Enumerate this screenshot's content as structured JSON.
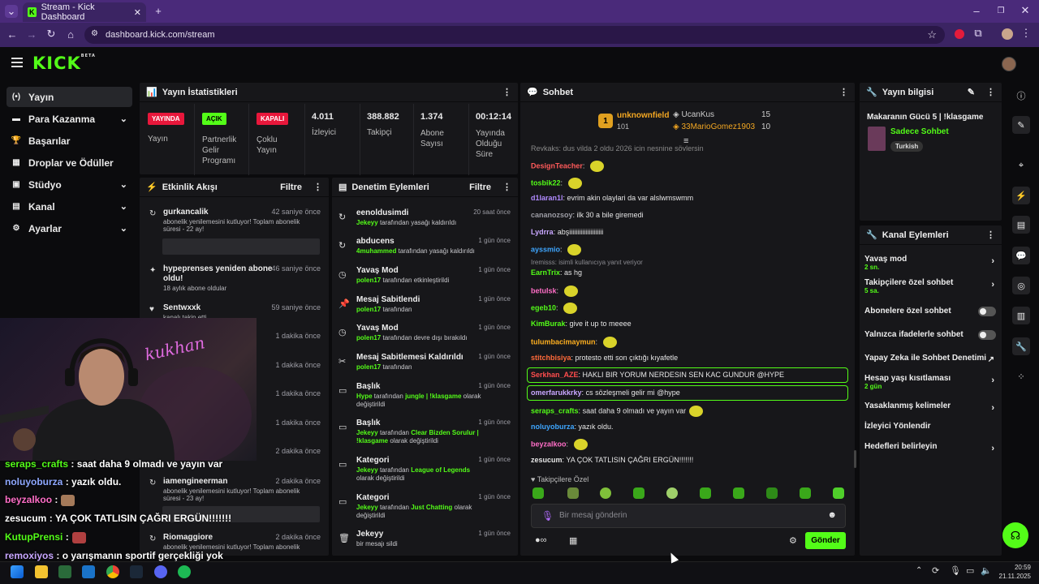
{
  "browser": {
    "tab_title": "Stream - Kick Dashboard",
    "url": "dashboard.kick.com/stream"
  },
  "header": {
    "logo": "KICK",
    "logo_badge": "BETA"
  },
  "sidebar": {
    "items": [
      {
        "label": "Yayın",
        "icon": "broadcast-icon",
        "active": true
      },
      {
        "label": "Para Kazanma",
        "icon": "money-icon",
        "expandable": true
      },
      {
        "label": "Başarılar",
        "icon": "trophy-icon"
      },
      {
        "label": "Droplar ve Ödüller",
        "icon": "gift-icon"
      },
      {
        "label": "Stüdyo",
        "icon": "studio-icon",
        "expandable": true
      },
      {
        "label": "Kanal",
        "icon": "channel-icon",
        "expandable": true
      },
      {
        "label": "Ayarlar",
        "icon": "settings-icon",
        "expandable": true
      }
    ]
  },
  "stats": {
    "title": "Yayın İstatistikleri",
    "live": {
      "badge": "YAYINDA",
      "label": "Yayın"
    },
    "affiliate": {
      "badge": "AÇIK",
      "label": "Partnerlik Gelir Programı"
    },
    "multistream": {
      "badge": "KAPALI",
      "label": "Çoklu Yayın"
    },
    "viewers": {
      "value": "4.011",
      "label": "İzleyici"
    },
    "followers": {
      "value": "388.882",
      "label": "Takipçi"
    },
    "subs": {
      "value": "1.374",
      "label": "Abone Sayısı"
    },
    "uptime": {
      "value": "00:12:14",
      "label": "Yayında Olduğu Süre"
    },
    "colors": {
      "live": "#e8173b",
      "on": "#53fc18",
      "off": "#e8173b"
    }
  },
  "activity": {
    "title": "Etkinlik Akışı",
    "filter": "Filtre",
    "items": [
      {
        "name": "gurkancalik",
        "time": "42 saniye önce",
        "desc": "abonelik yenilemesini kutluyor! Toplam abonelik süresi - 22 ay!"
      },
      {
        "name": "hypeprenses yeniden abone oldu!",
        "time": "46 saniye önce",
        "desc": "18 aylık abone oldular"
      },
      {
        "name": "Sentwxxk",
        "time": "59 saniye önce",
        "desc": "kanalı takip etti"
      },
      {
        "name": "",
        "time": "1 dakika önce",
        "desc": ""
      },
      {
        "name": "",
        "time": "1 dakika önce",
        "desc": ""
      },
      {
        "name": "",
        "time": "1 dakika önce",
        "desc": ""
      },
      {
        "name": "",
        "time": "1 dakika önce",
        "desc": ""
      },
      {
        "name": "",
        "time": "2 dakika önce",
        "desc": ""
      },
      {
        "name": "iamengineerman",
        "time": "2 dakika önce",
        "desc": "abonelik yenilemesini kutluyor! Toplam abonelik süresi - 23 ay!"
      },
      {
        "name": "Riomaggiore",
        "time": "2 dakika önce",
        "desc": "abonelik yenilemesini kutluyor! Toplam abonelik"
      }
    ]
  },
  "moderation": {
    "title": "Denetim Eylemleri",
    "filter": "Filtre",
    "items": [
      {
        "name": "eenoldusimdi",
        "time": "20 saat önce",
        "who": "Jekeyy",
        "text": "tarafından yasağı kaldırıldı"
      },
      {
        "name": "abducens",
        "time": "1 gün önce",
        "who": "4muhammed",
        "text": "tarafından yasağı kaldırıldı"
      },
      {
        "name": "Yavaş Mod",
        "time": "1 gün önce",
        "who": "polen17",
        "text": "tarafından etkinleştirildi"
      },
      {
        "name": "Mesaj Sabitlendi",
        "time": "1 gün önce",
        "who": "polen17",
        "text": "tarafından"
      },
      {
        "name": "Yavaş Mod",
        "time": "1 gün önce",
        "who": "polen17",
        "text": "tarafından devre dışı bırakıldı"
      },
      {
        "name": "Mesaj Sabitlemesi Kaldırıldı",
        "time": "1 gün önce",
        "who": "polen17",
        "text": "tarafından"
      },
      {
        "name": "Başlık",
        "time": "1 gün önce",
        "who": "Hype",
        "text": "tarafından",
        "hl": "jungle | !klasgame",
        "tail": "olarak değiştirildi"
      },
      {
        "name": "Başlık",
        "time": "1 gün önce",
        "who": "Jekeyy",
        "text": "tarafından",
        "hl": "Clear Bizden Sorulur | !klasgame",
        "tail": "olarak değiştirildi"
      },
      {
        "name": "Kategori",
        "time": "1 gün önce",
        "who": "Jekeyy",
        "text": "tarafından",
        "hl": "League of Legends",
        "tail": "olarak değiştirildi"
      },
      {
        "name": "Kategori",
        "time": "1 gün önce",
        "who": "Jekeyy",
        "text": "tarafından",
        "hl": "Just Chatting",
        "tail": "olarak değiştirildi"
      },
      {
        "name": "Jekeyy",
        "time": "1 gün önce",
        "who": "",
        "text": "bir mesajı sildi"
      }
    ]
  },
  "chat": {
    "title": "Sohbet",
    "leaders": [
      {
        "name": "unknownfield",
        "count": "101"
      },
      {
        "name": "UcanKus",
        "count": "15"
      },
      {
        "name": "33MarioGomez1903",
        "count": "10"
      }
    ],
    "cut_line": "Reykaks: dus yilda 2 oldu 2026 için nesnine söylersin",
    "messages": [
      {
        "user": "DesignTeacher",
        "color": "#ff5a5a",
        "text": "",
        "emote": true
      },
      {
        "user": "tosbik22",
        "color": "#53fc18",
        "text": "",
        "emote": true
      },
      {
        "user": "d1laran1l",
        "color": "#b18bff",
        "text": "evrim akin olaylari da var alslwmswmm"
      },
      {
        "user": "cananozsoy",
        "color": "#9c9ca4",
        "text": "ilk 30 a bile giremedi"
      },
      {
        "user": "Lydrra",
        "color": "#c8a6ff",
        "text": "abşiiiiiiiiiiiiiiiiiiiii"
      },
      {
        "user": "ayssmio",
        "color": "#3ea6ff",
        "text": "",
        "emote": true
      },
      {
        "user": "EarnTrix",
        "color": "#53fc18",
        "text": "as hg",
        "reply": "Iremisss: isimli kullanıcıya yanıt veriyor"
      },
      {
        "user": "betulsk",
        "color": "#ff6ec7",
        "text": "",
        "emote": true
      },
      {
        "user": "egeb10",
        "color": "#53fc18",
        "text": "",
        "emote": true
      },
      {
        "user": "KimBurak",
        "color": "#53fc18",
        "text": "give it up to meeee"
      },
      {
        "user": "tulumbacimaymun",
        "color": "#ffb020",
        "text": "",
        "emote": true
      },
      {
        "user": "stitchbisiya",
        "color": "#ff6a3a",
        "text": "protesto etti son çıktığı kıyafetle"
      },
      {
        "user": "Serkhan_AZE",
        "color": "#ff4d4d",
        "text": "HAKLI BIR YORUM NERDESIN SEN KAC GUNDUR @HYPE",
        "highlight": true
      },
      {
        "user": "omerfarukkrky",
        "color": "#c8a6ff",
        "text": "cs sözleşmeli gelir mi @hype",
        "highlight": true
      },
      {
        "user": "seraps_crafts",
        "color": "#53fc18",
        "text": "saat daha 9 olmadı ve yayın var",
        "emote": true
      },
      {
        "user": "noluyoburza",
        "color": "#3ea6ff",
        "text": "yazık oldu."
      },
      {
        "user": "beyzalkoo",
        "color": "#ff6ec7",
        "text": "",
        "emote": true
      },
      {
        "user": "zesucum",
        "color": "#e6e6e6",
        "text": "YA ÇOK TATLISIN ÇAĞRI ERGÜN!!!!!!!"
      }
    ],
    "followers_only_label": "Takipçilere Özel",
    "input_placeholder": "Bir mesaj gönderin",
    "send_label": "Gönder"
  },
  "stream_info": {
    "title": "Yayın bilgisi",
    "stream_title": "Makaranın Gücü 5 | !klasgame",
    "category": "Sadece Sohbet",
    "tag": "Turkish"
  },
  "channel_actions": {
    "title": "Kanal Eylemleri",
    "items": [
      {
        "label": "Yavaş mod",
        "sub": "2 sn.",
        "type": "chevron"
      },
      {
        "label": "Takipçilere özel sohbet",
        "sub": "5 sa.",
        "type": "chevron"
      },
      {
        "label": "Abonelere özel sohbet",
        "type": "toggle"
      },
      {
        "label": "Yalnızca ifadelerle sohbet",
        "type": "toggle"
      },
      {
        "label": "Yapay Zeka ile Sohbet Denetimi",
        "type": "external"
      },
      {
        "label": "Hesap yaşı kısıtlaması",
        "sub": "2 gün",
        "type": "chevron"
      },
      {
        "label": "Yasaklanmış kelimeler",
        "type": "chevron"
      },
      {
        "label": "İzleyici Yönlendir",
        "type": "none"
      },
      {
        "label": "Hedefleri belirleyin",
        "type": "chevron"
      }
    ]
  },
  "overlay_chat": [
    {
      "user": "seraps_crafts",
      "text": ": saat daha 9 olmadı ve yayın var"
    },
    {
      "user": "noluyoburza",
      "text": ": yazık oldu."
    },
    {
      "user": "beyzalkoo",
      "text": ":"
    },
    {
      "user": "zesucum",
      "text": ": YA ÇOK TATLISIN ÇAĞRI ERGÜN!!!!!!!"
    },
    {
      "user": "KutupPrensi",
      "text": ":"
    },
    {
      "user": "remoxiyos",
      "text": ": o yarışmanın sportif gerçekliği yok"
    }
  ],
  "webcam_sign": "kukhan",
  "taskbar": {
    "time": "20:59",
    "date": "21.11.2025"
  }
}
